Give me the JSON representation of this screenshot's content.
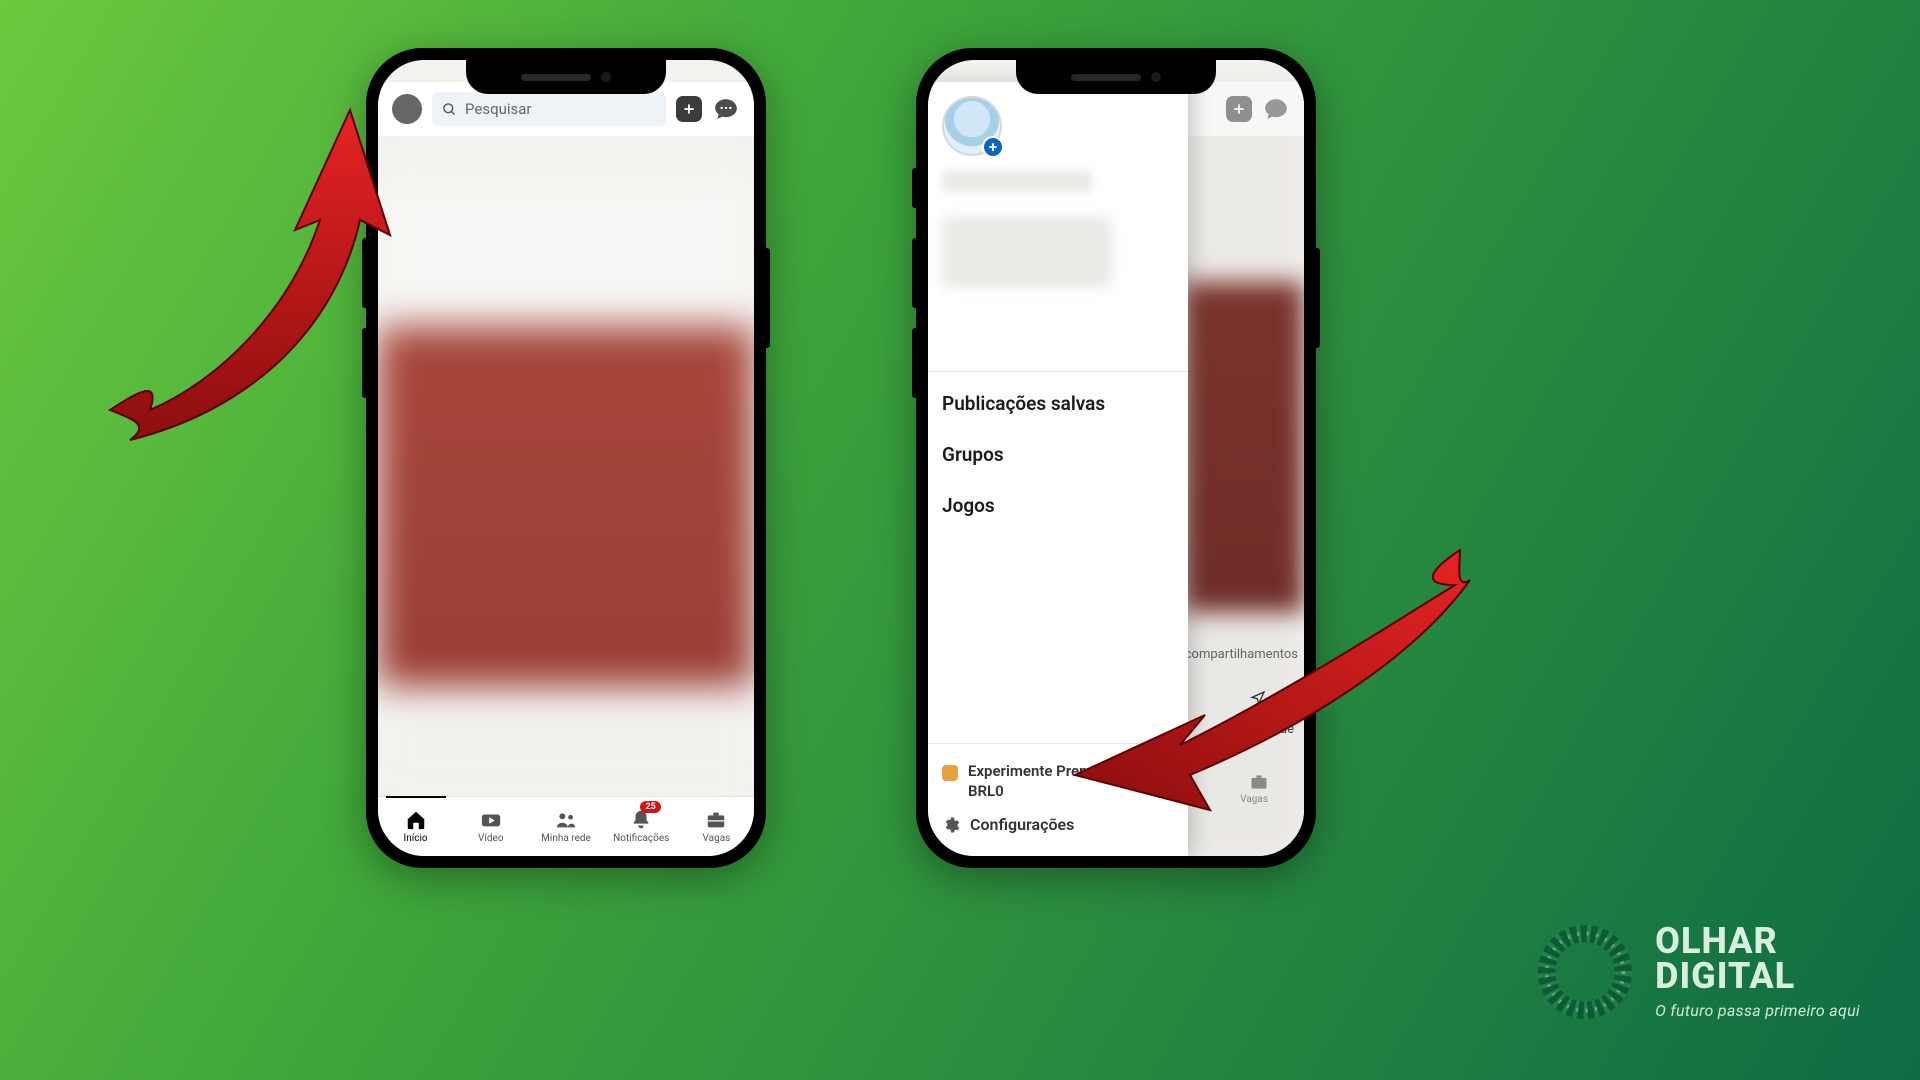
{
  "phone1": {
    "search_placeholder": "Pesquisar",
    "bottom_nav": [
      {
        "label": "Início",
        "active": true
      },
      {
        "label": "Vídeo"
      },
      {
        "label": "Minha rede"
      },
      {
        "label": "Notificações",
        "badge": "25"
      },
      {
        "label": "Vagas"
      }
    ]
  },
  "phone2": {
    "drawer": {
      "items": [
        "Publicações salvas",
        "Grupos",
        "Jogos"
      ],
      "premium": "Experimente Premium por BRL0",
      "settings": "Configurações"
    },
    "peek": {
      "compart": "compartilhamentos",
      "enviar": "Enviar",
      "nidade": "nidade",
      "vagas": "Vagas"
    }
  },
  "brand": {
    "line1": "OLHAR",
    "line2": "DIGITAL",
    "tagline": "O futuro passa primeiro aqui"
  }
}
